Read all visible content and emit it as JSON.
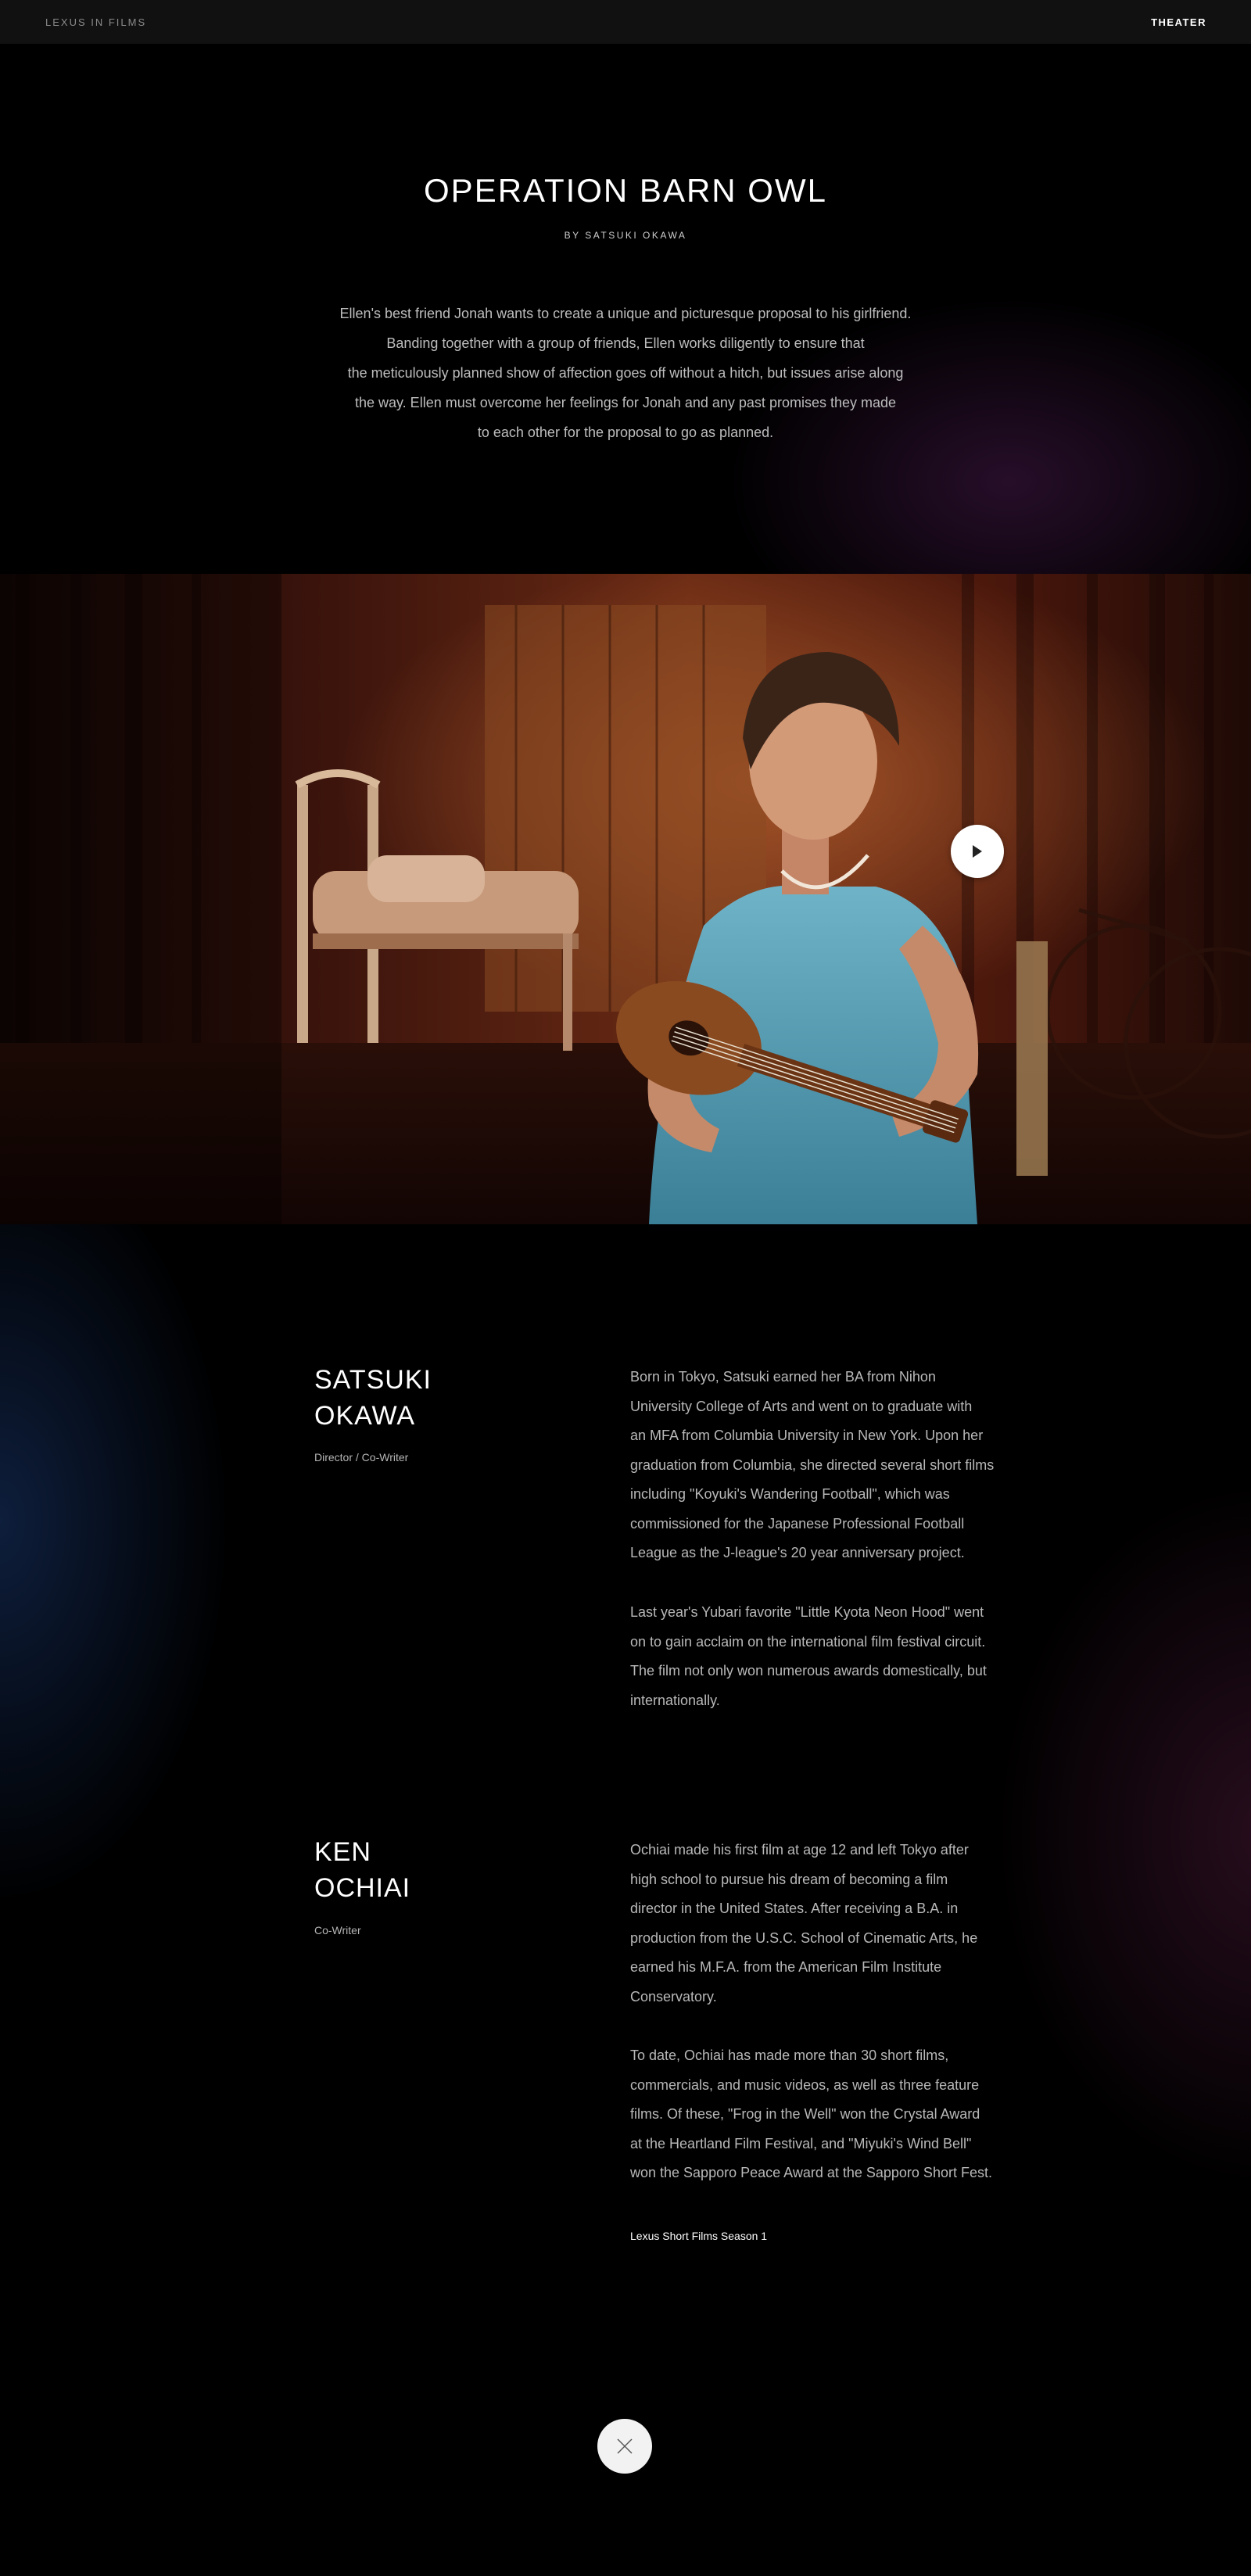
{
  "header": {
    "brand": "LEXUS IN FILMS",
    "nav_theater": "THEATER"
  },
  "film": {
    "title": "OPERATION BARN OWL",
    "byline": "BY SATSUKI OKAWA",
    "synopsis_lines": [
      "Ellen's best friend Jonah wants to create a unique and picturesque proposal to his girlfriend.",
      "Banding together with a group of friends, Ellen works diligently to ensure that",
      "the meticulously planned show of affection goes off without a hitch, but issues arise along",
      "the way. Ellen must overcome her feelings for Jonah and any past promises they made",
      "to each other for the proposal to go as planned."
    ]
  },
  "video": {
    "play_icon": "play-icon"
  },
  "bios": [
    {
      "name_line1": "SATSUKI",
      "name_line2": "OKAWA",
      "role": "Director / Co-Writer",
      "paragraph1_lines": [
        "Born in Tokyo, Satsuki earned her BA from Nihon",
        "University College of Arts and went on to graduate with",
        "an MFA from Columbia University in New York. Upon her",
        "graduation from Columbia, she directed several short films",
        "including \"Koyuki's Wandering Football\", which was",
        "commissioned for the Japanese Professional Football",
        "League as the J-league's 20 year anniversary project."
      ],
      "paragraph2_lines": [
        "Last year's Yubari favorite \"Little Kyota Neon Hood\" went",
        "on to gain acclaim on the international film festival circuit.",
        "The film not only won numerous awards domestically, but",
        "internationally."
      ]
    },
    {
      "name_line1": "KEN",
      "name_line2": "OCHIAI",
      "role": "Co-Writer",
      "paragraph1_lines": [
        "Ochiai made his first film at age 12 and left Tokyo after",
        "high school to pursue his dream of becoming a film",
        "director in the United States. After receiving a B.A. in",
        "production from the U.S.C. School of Cinematic Arts, he",
        "earned his M.F.A. from the American Film Institute",
        "Conservatory."
      ],
      "paragraph2_lines": [
        "To date, Ochiai has made more than 30 short films,",
        "commercials, and music videos, as well as three feature",
        "films. Of these, \"Frog in the Well\" won the Crystal Award",
        "at the Heartland Film Festival, and \"Miyuki's Wind Bell\"",
        "won the Sapporo Peace Award at the Sapporo Short Fest."
      ]
    }
  ],
  "season_link": "Lexus Short Films Season 1",
  "close_icon": "close-icon"
}
